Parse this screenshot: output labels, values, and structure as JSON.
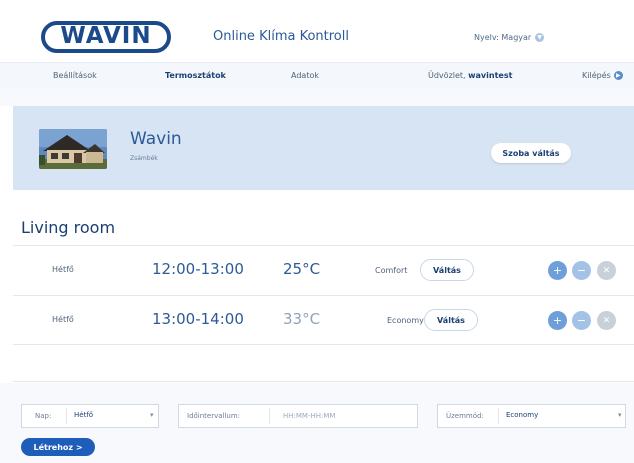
{
  "header": {
    "logo_text": "WAVIN",
    "app_title": "Online Klíma Kontroll",
    "language_label": "Nyelv: Magyar"
  },
  "nav": {
    "settings": "Beállítások",
    "thermostats": "Termosztátok",
    "data": "Adatok",
    "welcome_prefix": "Üdvözlet,",
    "username": "wavintest",
    "logout": "Kilépés"
  },
  "room": {
    "name": "Wavin",
    "location": "Zsámbék",
    "switch_label": "Szoba váltás"
  },
  "section_title": "Living room",
  "schedule": [
    {
      "day": "Hétfő",
      "time": "12:00-13:00",
      "temp": "25°C",
      "mode": "Comfort",
      "switch_label": "Váltás",
      "temp_color": "#2c5a96"
    },
    {
      "day": "Hétfő",
      "time": "13:00-14:00",
      "temp": "33°C",
      "mode": "Economy",
      "switch_label": "Váltás",
      "temp_color": "#8fa3bb"
    }
  ],
  "controls": {
    "plus": "+",
    "minus": "−",
    "delete": "✕"
  },
  "form": {
    "day_label": "Nap:",
    "day_value": "Hétfő",
    "interval_label": "Időintervallum:",
    "interval_placeholder": "HH:MM-HH:MM",
    "mode_label": "Üzemmód:",
    "mode_value": "Economy",
    "create_label": "Létrehoz  >"
  },
  "colors": {
    "brand": "#1b4a8a",
    "panel": "#d6e4f3",
    "create_button": "#1f5dbb"
  }
}
